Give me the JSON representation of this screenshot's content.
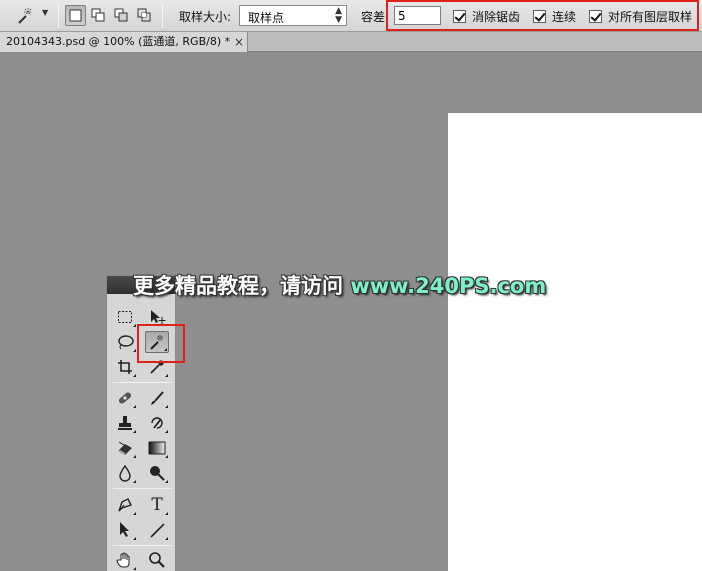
{
  "options_bar": {
    "sample_size_label": "取样大小:",
    "sample_size_value": "取样点",
    "tolerance_label": "容差:",
    "tolerance_value": "5",
    "anti_alias_label": "消除锯齿",
    "contiguous_label": "连续",
    "sample_all_layers_label": "对所有图层取样",
    "checkboxes_checked": {
      "anti_alias": true,
      "contiguous": true,
      "sample_all_layers": true
    }
  },
  "document_tab": {
    "title": "20104343.psd @ 100% (蓝通道, RGB/8) *",
    "close_glyph": "×"
  },
  "watermark": {
    "text": "更多精品教程，请访问 ",
    "url": "www.240PS.com"
  },
  "tools_panel": {
    "type_tool_glyph": "T"
  },
  "colors": {
    "highlight": "#e0201a",
    "workspace": "#8e8e8e",
    "canvas": "#ffffff"
  }
}
